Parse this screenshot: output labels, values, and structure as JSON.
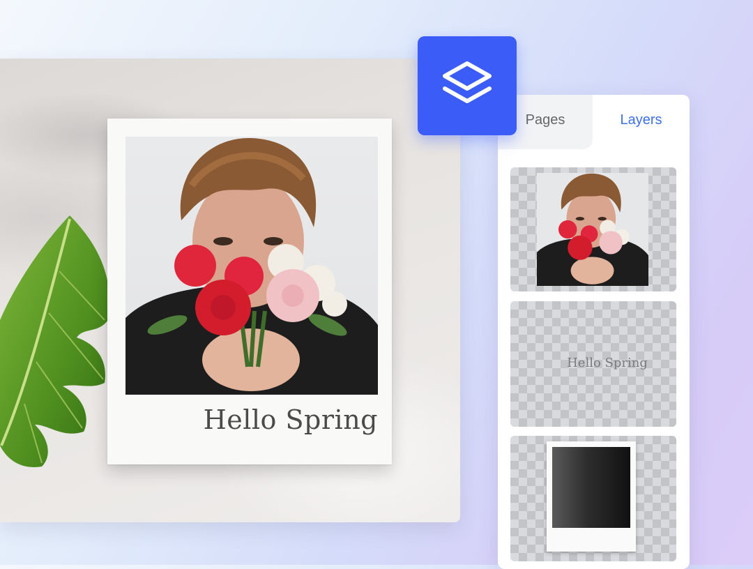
{
  "canvas": {
    "caption": "Hello Spring"
  },
  "layers_button": {
    "icon": "layers-icon",
    "color": "#3b5cf6"
  },
  "panel": {
    "tabs": [
      {
        "label": "Pages",
        "active": false
      },
      {
        "label": "Layers",
        "active": true
      }
    ],
    "layers": [
      {
        "type": "image",
        "icon": "photo-thumbnail"
      },
      {
        "type": "text",
        "text": "Hello Spring"
      },
      {
        "type": "frame",
        "icon": "polaroid-frame-thumbnail"
      }
    ]
  },
  "colors": {
    "accent": "#3b5cf6",
    "active_tab": "#3b6fec"
  }
}
